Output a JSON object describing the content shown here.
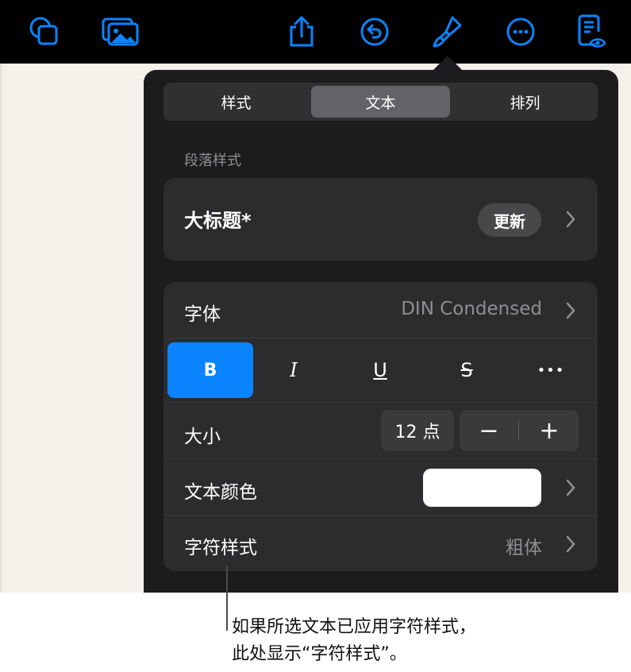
{
  "toolbar": {
    "icons": [
      "shapes-icon",
      "media-icon",
      "share-icon",
      "undo-icon",
      "format-brush-icon",
      "more-icon",
      "reader-view-icon"
    ],
    "accent_color": "#0a84ff"
  },
  "tabs": [
    {
      "label": "样式",
      "active": false
    },
    {
      "label": "文本",
      "active": true
    },
    {
      "label": "排列",
      "active": false
    }
  ],
  "paragraph_style": {
    "section_label": "段落样式",
    "name": "大标题*",
    "update_label": "更新"
  },
  "font_row": {
    "label": "字体",
    "value": "DIN Condensed"
  },
  "format_buttons": {
    "bold": "B",
    "italic": "I",
    "underline": "U",
    "strikethrough": "S",
    "more": "•••",
    "active": "bold"
  },
  "size_row": {
    "label": "大小",
    "value": "12 点",
    "decrease": "−",
    "increase": "+"
  },
  "color_row": {
    "label": "文本颜色",
    "swatch_color": "#ffffff"
  },
  "char_style_row": {
    "label": "字符样式",
    "value": "粗体"
  },
  "callout": {
    "line1": "如果所选文本已应用字符样式，",
    "line2": "此处显示“字符样式”。"
  }
}
